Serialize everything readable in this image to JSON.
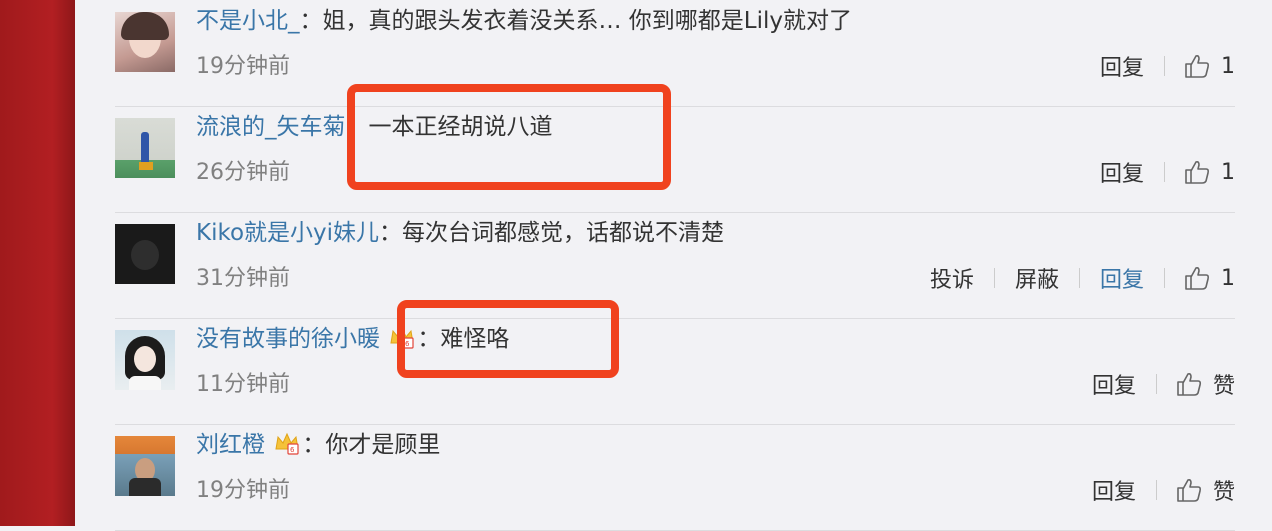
{
  "comments": [
    {
      "username": "不是小北_",
      "separator": "：",
      "text": "姐，真的跟头发衣着没关系… 你到哪都是Lily就对了",
      "time": "19分钟前",
      "reply_label": "回复",
      "like_label": "1"
    },
    {
      "username": "流浪的_矢车菊",
      "separator": "：",
      "text": "一本正经胡说八道",
      "time": "26分钟前",
      "reply_label": "回复",
      "like_label": "1"
    },
    {
      "username": "Kiko就是小yi妹儿",
      "separator": "：",
      "text": "每次台词都感觉，话都说不清楚",
      "time": "31分钟前",
      "report_label": "投诉",
      "block_label": "屏蔽",
      "reply_label": "回复",
      "like_label": "1"
    },
    {
      "username": "没有故事的徐小暖",
      "separator": "：",
      "text": "难怪咯",
      "time": "11分钟前",
      "reply_label": "回复",
      "like_label": "赞"
    },
    {
      "username": "刘红橙",
      "separator": "：",
      "text": "你才是顾里",
      "time": "19分钟前",
      "reply_label": "回复",
      "like_label": "赞"
    }
  ],
  "colors": {
    "username": "#3a76a8",
    "highlight": "#f0421e",
    "sidebar": "#b21f22"
  }
}
